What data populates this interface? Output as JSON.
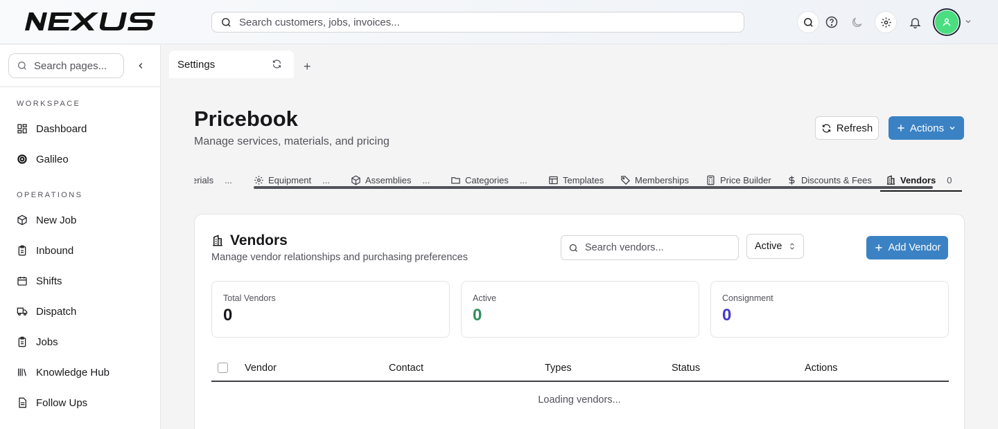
{
  "app": {
    "logo_text": "NEXUS",
    "global_search_placeholder": "Search customers, jobs, invoices...",
    "header_icons": [
      "search-icon",
      "help-icon",
      "moon-icon",
      "gear-icon",
      "bell-icon",
      "user-icon",
      "chevron-down-icon"
    ]
  },
  "sidebar": {
    "search_placeholder": "Search pages...",
    "sections": [
      {
        "label": "WORKSPACE",
        "items": [
          {
            "label": "Dashboard",
            "icon": "dashboard-icon"
          },
          {
            "label": "Galileo",
            "icon": "galileo-icon"
          }
        ]
      },
      {
        "label": "OPERATIONS",
        "items": [
          {
            "label": "New Job",
            "icon": "package-icon"
          },
          {
            "label": "Inbound",
            "icon": "clipboard-icon"
          },
          {
            "label": "Shifts",
            "icon": "calendar-icon"
          },
          {
            "label": "Dispatch",
            "icon": "truck-icon"
          },
          {
            "label": "Jobs",
            "icon": "clipboard-icon"
          },
          {
            "label": "Knowledge Hub",
            "icon": "library-icon"
          },
          {
            "label": "Follow Ups",
            "icon": "document-icon"
          }
        ]
      }
    ]
  },
  "tabs": {
    "active_label": "Settings"
  },
  "page": {
    "title": "Pricebook",
    "subtitle": "Manage services, materials, and pricing",
    "refresh_label": "Refresh",
    "actions_label": "Actions"
  },
  "subtabs": [
    {
      "label": "erials",
      "icon": "",
      "more": "..."
    },
    {
      "label": "Equipment",
      "icon": "gear-icon",
      "more": "..."
    },
    {
      "label": "Assemblies",
      "icon": "box-icon",
      "more": "..."
    },
    {
      "label": "Categories",
      "icon": "folder-icon",
      "more": "..."
    },
    {
      "label": "Templates",
      "icon": "template-icon",
      "more": ""
    },
    {
      "label": "Memberships",
      "icon": "tag-icon",
      "more": ""
    },
    {
      "label": "Price Builder",
      "icon": "calculator-icon",
      "more": ""
    },
    {
      "label": "Discounts & Fees",
      "icon": "dollar-icon",
      "more": ""
    },
    {
      "label": "Vendors",
      "icon": "building-icon",
      "count": "0",
      "active": true
    }
  ],
  "vendors": {
    "title": "Vendors",
    "subtitle": "Manage vendor relationships and purchasing preferences",
    "search_placeholder": "Search vendors...",
    "status_filter": "Active",
    "add_label": "Add Vendor",
    "stats": [
      {
        "label": "Total Vendors",
        "value": "0",
        "color": "#18181b"
      },
      {
        "label": "Active",
        "value": "0",
        "color": "#16a34a"
      },
      {
        "label": "Consignment",
        "value": "0",
        "color": "#4338ca"
      }
    ],
    "columns": [
      "Vendor",
      "Contact",
      "Types",
      "Status",
      "Actions"
    ],
    "loading_text": "Loading vendors..."
  }
}
